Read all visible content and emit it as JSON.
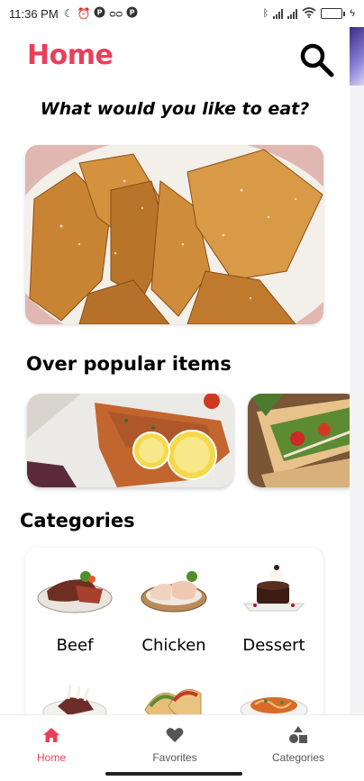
{
  "status_bar": {
    "time": "11:36 PM",
    "left_icons": [
      "moon-icon",
      "alarm-icon",
      "notification-p-icon",
      "voicemail-icon",
      "notification-p-icon"
    ],
    "right_icons": [
      "bluetooth-icon",
      "signal-icon",
      "signal-icon",
      "wifi-icon",
      "battery-icon",
      "charging-icon"
    ],
    "battery_level": 0.82
  },
  "header": {
    "title": "Home",
    "title_color": "#e8405a",
    "search_icon": "search-icon"
  },
  "subtitle": "What would you like to eat?",
  "sections": {
    "popular_title": "Over popular items",
    "categories_title": "Categories"
  },
  "categories": [
    {
      "label": "Beef"
    },
    {
      "label": "Chicken"
    },
    {
      "label": "Dessert"
    },
    {
      "label": ""
    },
    {
      "label": ""
    },
    {
      "label": ""
    }
  ],
  "bottom_nav": {
    "items": [
      {
        "label": "Home",
        "icon": "home-icon",
        "active": true
      },
      {
        "label": "Favorites",
        "icon": "heart-icon",
        "active": false
      },
      {
        "label": "Categories",
        "icon": "shapes-icon",
        "active": false
      }
    ],
    "accent": "#e8405a"
  }
}
